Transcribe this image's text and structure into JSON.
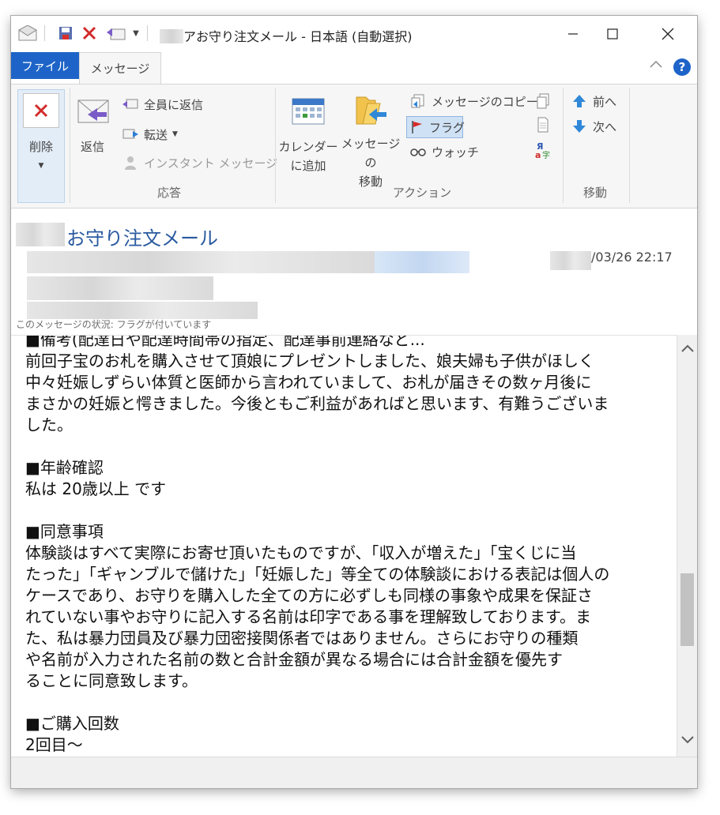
{
  "window": {
    "title_suffix": "アお守り注文メール - 日本語 (自動選択)"
  },
  "tabs": {
    "file": "ファイル",
    "message": "メッセージ"
  },
  "ribbon": {
    "delete_group": {
      "delete": "削除"
    },
    "respond_group": {
      "label": "応答",
      "reply": "返信",
      "reply_all": "全員に返信",
      "forward": "転送",
      "instant_message": "インスタント メッセージ"
    },
    "actions_group": {
      "label": "アクション",
      "calendar_line1": "カレンダー",
      "calendar_line2": "に追加",
      "move_line1": "メッセージの",
      "move_line2": "移動",
      "copy": "メッセージのコピー",
      "flag": "フラグ",
      "watch": "ウォッチ"
    },
    "move_group": {
      "label": "移動",
      "prev": "前へ",
      "next": "次へ"
    }
  },
  "message": {
    "subject": "お守り注文メール",
    "date": "/03/26 22:17",
    "info_bar": "このメッセージの状況: フラグが付いています",
    "body": "■備考(配達日や配達時間帯の指定、配達事前連絡など...\n前回子宝のお札を購入させて頂娘にプレゼントしました、娘夫婦も子供がほしく\n中々妊娠しずらい体質と医師から言われていまして、お札が届きその数ヶ月後に\nまさかの妊娠と愕きました。今後ともご利益があればと思います、有難うございま\nした。\n\n■年齢確認\n私は 20歳以上 です\n\n■同意事項\n体験談はすべて実際にお寄せ頂いたものですが、「収入が増えた」「宝くじに当\nたった」「ギャンブルで儲けた」「妊娠した」等全ての体験談における表記は個人の\nケースであり、お守りを購入した全ての方に必ずしも同様の事象や成果を保証さ\nれていない事やお守りに記入する名前は印字である事を理解致しております。ま\nた、私は暴力団員及び暴力団密接関係者ではありません。さらにお守りの種類\nや名前が入力された名前の数と合計金額が異なる場合には合計金額を優先す\nることに同意致します。\n\n■ご購入回数\n2回目〜"
  }
}
